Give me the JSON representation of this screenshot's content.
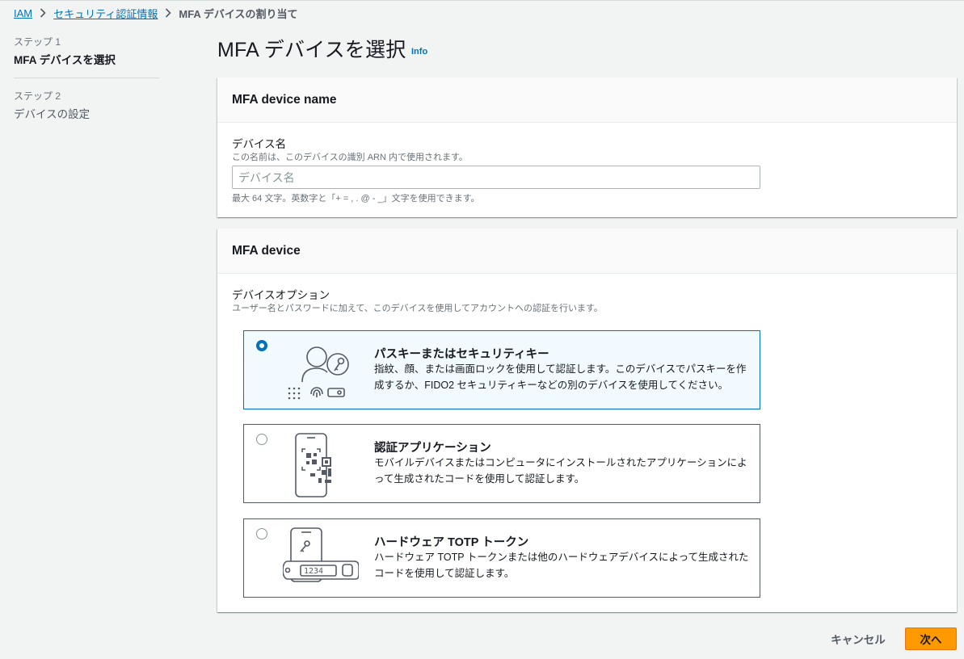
{
  "breadcrumb": {
    "items": [
      {
        "label": "IAM"
      },
      {
        "label": "セキュリティ認証情報"
      }
    ],
    "current": "MFA デバイスの割り当て"
  },
  "steps": [
    {
      "step": "ステップ 1",
      "title": "MFA デバイスを選択",
      "active": true
    },
    {
      "step": "ステップ 2",
      "title": "デバイスの設定",
      "active": false
    }
  ],
  "page": {
    "title": "MFA デバイスを選択",
    "info": "Info"
  },
  "device_name_panel": {
    "header": "MFA device name",
    "label": "デバイス名",
    "description": "この名前は、このデバイスの識別 ARN 内で使用されます。",
    "value": "",
    "placeholder": "デバイス名",
    "constraint": "最大 64 文字。英数字と「+ = , . @ - _」文字を使用できます。"
  },
  "device_panel": {
    "header": "MFA device",
    "label": "デバイスオプション",
    "description": "ユーザー名とパスワードに加えて、このデバイスを使用してアカウントへの認証を行います。",
    "options": [
      {
        "title": "パスキーまたはセキュリティキー",
        "description": "指紋、顔、または画面ロックを使用して認証します。このデバイスでパスキーを作成するか、FIDO2 セキュリティキーなどの別のデバイスを使用してください。",
        "selected": true,
        "icon": "passkey-illustration"
      },
      {
        "title": "認証アプリケーション",
        "description": "モバイルデバイスまたはコンピュータにインストールされたアプリケーションによって生成されたコードを使用して認証します。",
        "selected": false,
        "icon": "authenticator-app-illustration"
      },
      {
        "title": "ハードウェア TOTP トークン",
        "description": "ハードウェア TOTP トークンまたは他のハードウェアデバイスによって生成されたコードを使用して認証します。",
        "selected": false,
        "icon": "hardware-token-illustration",
        "token_display": "1234"
      }
    ]
  },
  "footer": {
    "cancel": "キャンセル",
    "next": "次へ"
  },
  "colors": {
    "link": "#0073bb",
    "primary_button": "#ff9900",
    "selected_border": "#0073bb",
    "selected_background": "#f1faff",
    "page_background": "#f2f3f3"
  }
}
